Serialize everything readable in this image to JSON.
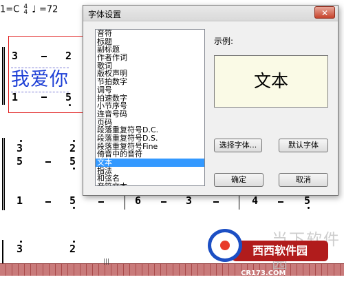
{
  "score": {
    "header_key": "1=C",
    "time_sig_top": "4",
    "time_sig_bottom": "4",
    "note_icon": "quarter-note-icon",
    "tempo": "=72",
    "lyrics_sample": "我爱你",
    "row1": {
      "n1": "3",
      "n2": "2",
      "n3": "1",
      "n4": "5"
    },
    "row2": {
      "n1": "3",
      "n2": "2",
      "n3": "5",
      "n4": "5"
    },
    "row3": {
      "n1": "1",
      "n2": "5",
      "n3": "6",
      "n4": "3",
      "n5": "4",
      "n6": "5"
    },
    "row4": {
      "n1": "3",
      "n2": "2"
    }
  },
  "dialog": {
    "title": "字体设置",
    "close_icon": "close-icon",
    "items": [
      "音符",
      "标题",
      "副标题",
      "作者作词",
      "歌词",
      "版权声明",
      "节拍数字",
      "调号",
      "拍速数字",
      "小节序号",
      "连音号码",
      "页码",
      "段落重复符号D.C.",
      "段落重复符号D.S.",
      "段落重复符号Fine",
      "倚音中的音符",
      "文本",
      "指法",
      "和弦名",
      "音符文本"
    ],
    "selected_item": "文本",
    "sample_label": "示例:",
    "sample_text": "文本",
    "choose_font_label": "选择字体...",
    "default_font_label": "默认字体",
    "ok_label": "确定",
    "cancel_label": "取消"
  },
  "ruler": {
    "grip": "|||"
  },
  "watermark": {
    "top_text": "当下软件园",
    "badge_text": "西西软件园",
    "site": "CR173.COM",
    "brand_color": "#b11c1c"
  }
}
